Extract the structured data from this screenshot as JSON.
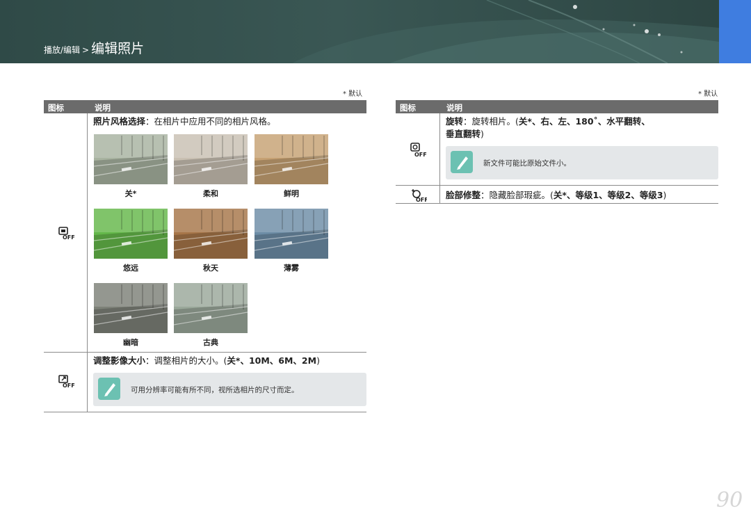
{
  "header": {
    "breadcrumb_section": "播放/编辑",
    "breadcrumb_separator": ">",
    "page_title": "编辑照片"
  },
  "left_table": {
    "legend": "* 默认",
    "col_icon": "图标",
    "col_desc": "说明",
    "style": {
      "title": "照片风格选择",
      "text": "：在相片中应用不同的相片风格。",
      "icon": "photo-style-off-icon",
      "thumbs": [
        {
          "label": "关*",
          "tint": "#a8b3a0"
        },
        {
          "label": "柔和",
          "tint": "#c9c0b2"
        },
        {
          "label": "鲜明",
          "tint": "#c6a173"
        },
        {
          "label": "悠远",
          "tint": "#64b84a"
        },
        {
          "label": "秋天",
          "tint": "#a77649"
        },
        {
          "label": "薄雾",
          "tint": "#6d8da6"
        },
        {
          "label": "幽暗",
          "tint": "#7d8178"
        },
        {
          "label": "古典",
          "tint": "#9aa89a"
        }
      ]
    },
    "resize": {
      "title": "调整影像大小",
      "text": "：调整相片的大小。(",
      "options": "关*、10M、6M、2M",
      "close": ")",
      "icon": "resize-off-icon",
      "note": "可用分辨率可能有所不同，视所选相片的尺寸而定。"
    }
  },
  "right_table": {
    "legend": "* 默认",
    "col_icon": "图标",
    "col_desc": "说明",
    "rotate": {
      "title": "旋转",
      "text": "：旋转相片。(",
      "options_line1": "关*、右、左、180˚、水平翻转、",
      "options_line2": "垂直翻转",
      "close": ")",
      "icon": "rotate-off-icon",
      "note": "新文件可能比原始文件小。"
    },
    "face": {
      "title": "脸部修整",
      "text": "：隐藏脸部瑕疵。(",
      "options": "关*、等级1、等级2、等级3",
      "close": ")",
      "icon": "face-retouch-off-icon"
    }
  },
  "page_number": "90"
}
